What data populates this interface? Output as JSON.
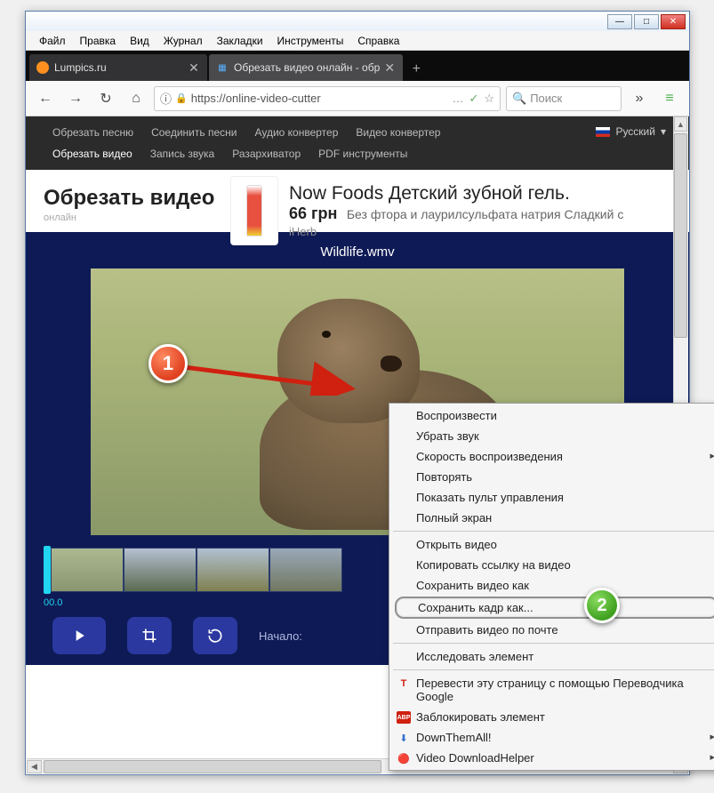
{
  "window": {
    "minimize": "—",
    "maximize": "□",
    "close": "✕"
  },
  "menubar": [
    "Файл",
    "Правка",
    "Вид",
    "Журнал",
    "Закладки",
    "Инструменты",
    "Справка"
  ],
  "tabs": [
    {
      "title": "Lumpics.ru",
      "favicon_color": "#ff9020"
    },
    {
      "title": "Обрезать видео онлайн - обр",
      "favicon_emoji": "🎬"
    }
  ],
  "newtab": "+",
  "nav": {
    "back": "←",
    "fwd": "→",
    "reload": "↻",
    "home": "⌂",
    "info": "ⓘ",
    "lock": "🔒",
    "url": "https://online-video-cutter",
    "ellipsis": "…",
    "star": "☆",
    "search_placeholder": "Поиск",
    "search_icon": "🔍",
    "overflow": "»",
    "profile": "☰"
  },
  "sitenav": {
    "items_row1": [
      "Обрезать песню",
      "Соединить песни",
      "Аудио конвертер",
      "Видео конвертер"
    ],
    "items_row2": [
      "Обрезать видео",
      "Запись звука",
      "Разархиватор",
      "PDF инструменты"
    ],
    "active": "Обрезать видео",
    "lang_label": "Русский",
    "lang_caret": "▾"
  },
  "hero": {
    "title": "Обрезать видео",
    "sub": "онлайн"
  },
  "ad": {
    "title": "Now Foods Детский зубной гель.",
    "price": "66 грн",
    "desc": "Без фтора и лаурилсульфата натрия Сладкий с",
    "seller": "iHerb"
  },
  "editor": {
    "filename": "Wildlife.wmv",
    "timestamp": "00.0",
    "controls": {
      "start_label": "Начало:"
    }
  },
  "steps": {
    "s1": "1",
    "s2": "2"
  },
  "context": {
    "play": "Воспроизвести",
    "mute": "Убрать звук",
    "speed": "Скорость воспроизведения",
    "loop": "Повторять",
    "show_controls": "Показать пульт управления",
    "fullscreen": "Полный экран",
    "open_video": "Открыть видео",
    "copy_link": "Копировать ссылку на видео",
    "save_video": "Сохранить видео как",
    "save_frame": "Сохранить кадр как...",
    "send_video": "Отправить видео по почте",
    "inspect": "Исследовать элемент",
    "translate": "Перевести эту страницу с помощью Переводчика Google",
    "adblock": "Заблокировать элемент",
    "dta": "DownThemAll!",
    "vdh": "Video DownloadHelper"
  }
}
